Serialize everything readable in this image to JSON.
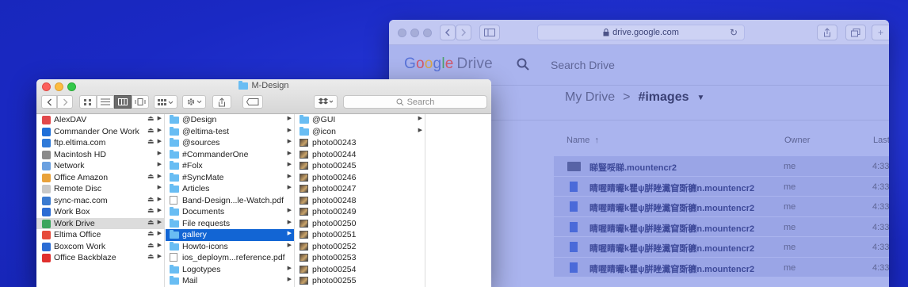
{
  "browser": {
    "url": "drive.google.com",
    "logo_letters": [
      "G",
      "o",
      "o",
      "g",
      "l",
      "e"
    ],
    "logo_product": "Drive",
    "search_placeholder": "Search Drive",
    "breadcrumb_root": "My Drive",
    "breadcrumb_sep": ">",
    "breadcrumb_current": "#images",
    "columns": {
      "name": "Name",
      "owner": "Owner",
      "last": "Last"
    },
    "rows": [
      {
        "name": "睇豎哸睇.mountencr2",
        "owner": "me",
        "time": "4:33",
        "type": "folder"
      },
      {
        "name": "睛喔睛曮k瞿ψ腁睉瀻窅斲穮n.mountencr2",
        "owner": "me",
        "time": "4:33",
        "type": "file"
      },
      {
        "name": "睛喔睛曮k瞿ψ腁睉瀻窅斲穮n.mountencr2",
        "owner": "me",
        "time": "4:33",
        "type": "file"
      },
      {
        "name": "睛喔睛曮k瞿ψ腁睉瀻窅斲穮n.mountencr2",
        "owner": "me",
        "time": "4:33",
        "type": "file"
      },
      {
        "name": "睛喔睛曮k瞿ψ腁睉瀻窅斲穮n.mountencr2",
        "owner": "me",
        "time": "4:33",
        "type": "file"
      },
      {
        "name": "睛喔睛曮k瞿ψ腁睉瀻窅斲穮n.mountencr2",
        "owner": "me",
        "time": "4:33",
        "type": "file"
      }
    ]
  },
  "finder": {
    "title": "M-Design",
    "search_placeholder": "Search",
    "sidebar": [
      {
        "label": "AlexDAV",
        "icon": "webdav-icon",
        "eject": true
      },
      {
        "label": "Commander One Work",
        "icon": "cloud-drive-icon",
        "eject": true
      },
      {
        "label": "ftp.eltima.com",
        "icon": "ftp-icon",
        "eject": true
      },
      {
        "label": "Macintosh HD",
        "icon": "hard-drive-icon",
        "eject": false
      },
      {
        "label": "Network",
        "icon": "network-icon",
        "eject": false
      },
      {
        "label": "Office Amazon",
        "icon": "amazon-icon",
        "eject": true
      },
      {
        "label": "Remote Disc",
        "icon": "disc-icon",
        "eject": false
      },
      {
        "label": "sync-mac.com",
        "icon": "server-icon",
        "eject": true
      },
      {
        "label": "Work Box",
        "icon": "box-icon",
        "eject": true
      },
      {
        "label": "Work Drive",
        "icon": "google-drive-icon",
        "eject": true,
        "selected": true
      },
      {
        "label": "Eltima Office",
        "icon": "office-icon",
        "eject": true
      },
      {
        "label": "Boxcom Work",
        "icon": "box-icon",
        "eject": true
      },
      {
        "label": "Office Backblaze",
        "icon": "backblaze-icon",
        "eject": true
      }
    ],
    "column2": [
      {
        "label": "@Design",
        "type": "folder"
      },
      {
        "label": "@eltima-test",
        "type": "folder"
      },
      {
        "label": "@sources",
        "type": "folder"
      },
      {
        "label": "#CommanderOne",
        "type": "folder"
      },
      {
        "label": "#Folx",
        "type": "folder"
      },
      {
        "label": "#SyncMate",
        "type": "folder"
      },
      {
        "label": "Articles",
        "type": "folder"
      },
      {
        "label": "Band-Design...le-Watch.pdf",
        "type": "doc"
      },
      {
        "label": "Documents",
        "type": "folder"
      },
      {
        "label": "File requests",
        "type": "folder"
      },
      {
        "label": "gallery",
        "type": "folder",
        "selected": true
      },
      {
        "label": "Howto-icons",
        "type": "folder"
      },
      {
        "label": "ios_deploym...reference.pdf",
        "type": "doc"
      },
      {
        "label": "Logotypes",
        "type": "folder"
      },
      {
        "label": "Mail",
        "type": "folder"
      }
    ],
    "column3": [
      {
        "label": "@GUI",
        "type": "folder"
      },
      {
        "label": "@icon",
        "type": "folder"
      },
      {
        "label": "photo00243",
        "type": "photo"
      },
      {
        "label": "photo00244",
        "type": "photo"
      },
      {
        "label": "photo00245",
        "type": "photo"
      },
      {
        "label": "photo00246",
        "type": "photo"
      },
      {
        "label": "photo00247",
        "type": "photo"
      },
      {
        "label": "photo00248",
        "type": "photo"
      },
      {
        "label": "photo00249",
        "type": "photo"
      },
      {
        "label": "photo00250",
        "type": "photo"
      },
      {
        "label": "photo00251",
        "type": "photo"
      },
      {
        "label": "photo00252",
        "type": "photo"
      },
      {
        "label": "photo00253",
        "type": "photo"
      },
      {
        "label": "photo00254",
        "type": "photo"
      },
      {
        "label": "photo00255",
        "type": "photo"
      }
    ]
  },
  "colors": {
    "background": "#1d2fd0",
    "finder_selection": "#1265d4",
    "folder": "#69bdf3"
  }
}
